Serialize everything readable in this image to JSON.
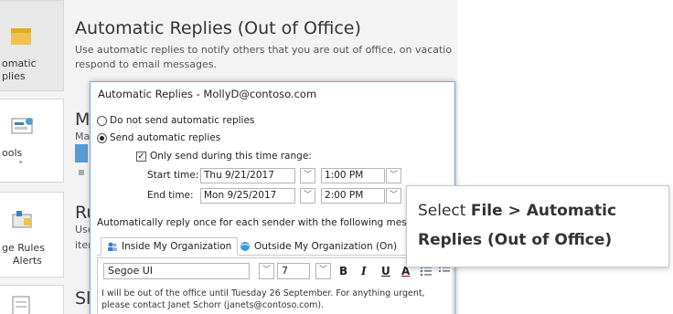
{
  "backstage": {
    "title": "Automatic Replies (Out of Office)",
    "description": "Use automatic replies to notify others that you are out of office, on vacatio respond to email messages.",
    "nav_items": [
      {
        "label_lines": [
          "omatic",
          "plies"
        ],
        "icon": "automatic-replies-icon"
      },
      {
        "label_lines": [
          "ools",
          "ˇ"
        ],
        "icon": "tools-icon"
      },
      {
        "label_lines": [
          "ge Rules",
          "Alerts"
        ],
        "icon": "rules-icon"
      },
      {
        "label_lines": [
          ""
        ],
        "icon": "slow-icon"
      }
    ],
    "headings": [
      {
        "text": "M",
        "sub": "Ma"
      },
      {
        "text": "Ru",
        "sub": "Use",
        "sub2": "iter"
      },
      {
        "text": "Sl",
        "sub": ""
      }
    ]
  },
  "dialog": {
    "title": "Automatic Replies - MollyD@contoso.com",
    "radio_do_not": "Do not send automatic replies",
    "radio_send": "Send automatic replies",
    "checkbox_range": "Only send during this time range:",
    "start_label": "Start time:",
    "start_date": "Thu 9/21/2017",
    "start_time": "1:00 PM",
    "end_label": "End time:",
    "end_date": "Mon 9/25/2017",
    "end_time": "2:00 PM",
    "auto_reply_text": "Automatically reply once for each sender with the following messages:",
    "tab_inside": "Inside My Organization",
    "tab_outside": "Outside My Organization (On)",
    "font_name": "Segoe UI",
    "font_size": "7",
    "bold": "B",
    "italic": "I",
    "underline": "U",
    "font_color": "A",
    "message": "I will be out of the office until Tuesday 26 September. For anything urgent, please contact Janet Schorr (janets@contoso.com)."
  },
  "callout": {
    "prefix": "Select ",
    "bold1": "File",
    "sep": " > ",
    "bold2": "Automatic Replies (Out of Office)"
  }
}
